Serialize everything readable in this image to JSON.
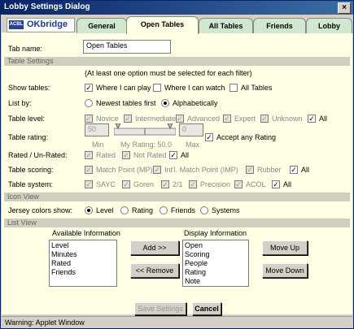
{
  "window": {
    "title": "Lobby Settings Dialog",
    "close_label": "×"
  },
  "logo": {
    "badge": "ACBL",
    "name": "OKbridge"
  },
  "tabs": [
    {
      "label": "General",
      "active": false
    },
    {
      "label": "Open Tables",
      "active": true
    },
    {
      "label": "All Tables",
      "active": false
    },
    {
      "label": "Friends",
      "active": false
    },
    {
      "label": "Lobby",
      "active": false
    }
  ],
  "tab_name": {
    "label": "Tab name:",
    "value": "Open Tables"
  },
  "sections": {
    "table_settings": "Table Settings",
    "icon_view": "Icon View",
    "list_view": "List View"
  },
  "filter_note": "(At least one option must be selected for each filter)",
  "show_tables": {
    "label": "Show tables:",
    "options": [
      {
        "label": "Where I can play",
        "checked": true
      },
      {
        "label": "Where I can watch",
        "checked": false
      },
      {
        "label": "All Tables",
        "checked": false
      }
    ]
  },
  "list_by": {
    "label": "List by:",
    "options": [
      {
        "label": "Newest tables first",
        "selected": false
      },
      {
        "label": "Alphabetically",
        "selected": true
      }
    ]
  },
  "table_level": {
    "label": "Table level:",
    "options": [
      {
        "label": "Novice",
        "checked": true
      },
      {
        "label": "Intermediate",
        "checked": true
      },
      {
        "label": "Advanced",
        "checked": true
      },
      {
        "label": "Expert",
        "checked": true
      },
      {
        "label": "Unknown",
        "checked": true
      },
      {
        "label": "All",
        "checked": true
      }
    ]
  },
  "table_rating": {
    "label": "Table rating:",
    "min_value": "50",
    "max_value": "0",
    "min_label": "Min",
    "max_label": "Max",
    "my_rating": "My Rating: 50.0",
    "accept_any": {
      "label": "Accept any Rating",
      "checked": true
    }
  },
  "rated": {
    "label": "Rated / Un-Rated:",
    "options": [
      {
        "label": "Rated",
        "checked": true
      },
      {
        "label": "Not Rated",
        "checked": true
      },
      {
        "label": "All",
        "checked": true
      }
    ]
  },
  "scoring": {
    "label": "Table scoring:",
    "options": [
      {
        "label": "Match Point (MP)",
        "checked": true
      },
      {
        "label": "Int'l. Match Point (IMP)",
        "checked": true
      },
      {
        "label": "Rubber",
        "checked": true
      },
      {
        "label": "All",
        "checked": true
      }
    ]
  },
  "system": {
    "label": "Table system:",
    "options": [
      {
        "label": "SAYC",
        "checked": true
      },
      {
        "label": "Goren",
        "checked": true
      },
      {
        "label": "2/1",
        "checked": true
      },
      {
        "label": "Precision",
        "checked": true
      },
      {
        "label": "ACOL",
        "checked": true
      },
      {
        "label": "All",
        "checked": true
      }
    ]
  },
  "jersey": {
    "label": "Jersey colors show:",
    "options": [
      {
        "label": "Level",
        "selected": true
      },
      {
        "label": "Rating",
        "selected": false
      },
      {
        "label": "Friends",
        "selected": false
      },
      {
        "label": "Systems",
        "selected": false
      }
    ]
  },
  "list_view": {
    "available_title": "Available Information",
    "available_items": [
      "Level",
      "Minutes",
      "Rated",
      "Friends"
    ],
    "display_title": "Display Information",
    "display_items": [
      "Open",
      "Scoring",
      "People",
      "Rating",
      "Note"
    ],
    "add_label": "Add >>",
    "remove_label": "<< Remove",
    "move_up_label": "Move Up",
    "move_down_label": "Move Down"
  },
  "footer": {
    "save_label": "Save Settings",
    "cancel_label": "Cancel"
  },
  "status": "Warning: Applet Window"
}
